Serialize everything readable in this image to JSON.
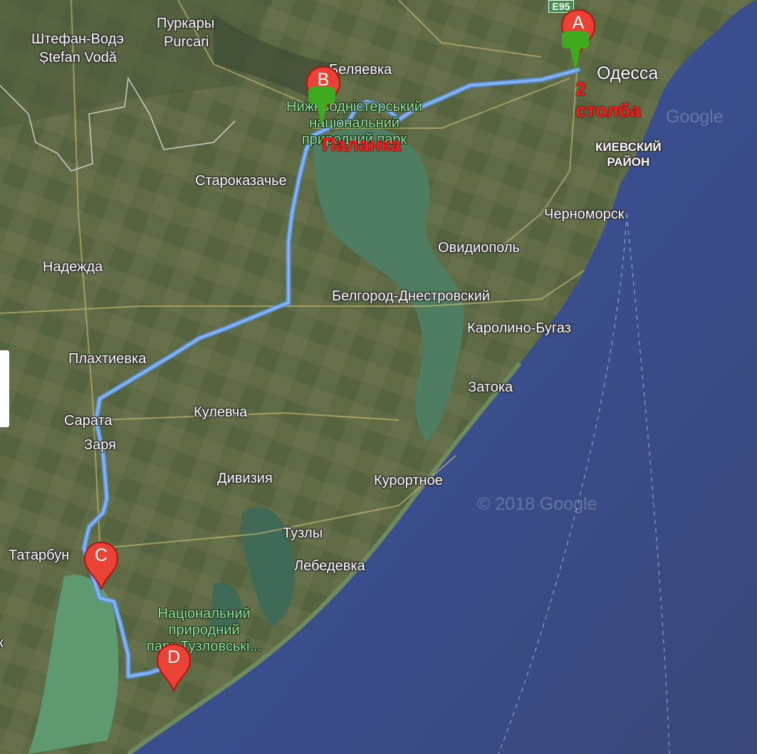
{
  "map": {
    "provider_watermark": "Google",
    "copyright": "© 2018 Google",
    "road_shield": "E95",
    "colors": {
      "land": "#5c6a45",
      "sea": "#3d4f93",
      "estuary": "#4e7d62",
      "route": "#7aaef0",
      "marker": "#ea4335",
      "flag": "#3faa1e",
      "annotation": "#ff1a1a"
    }
  },
  "places": {
    "shtefan_voda": "Штефан-Водэ",
    "shtefan_voda_latin": "Ștefan Vodă",
    "purkary": "Пуркары",
    "purcari": "Purcari",
    "belyaevka": "Беляевка",
    "odessa": "Одесса",
    "kievsky_district": "КИЕВСКИЙ\nРАЙОН",
    "starokazache": "Староказачье",
    "chernomorsk": "Черноморск",
    "ovidiopol": "Овидиополь",
    "nadezhda": "Надежда",
    "belgorod": "Белгород-Днестровский",
    "karolino": "Каролино-Бугаз",
    "plakhtievka": "Плахтиевка",
    "zatoka": "Затока",
    "sarata": "Сарата",
    "kulevcha": "Кулевча",
    "zarya": "Заря",
    "diviziya": "Дивизия",
    "kurortnoe": "Курортное",
    "tuzly": "Тузлы",
    "tatarbunary": "Татарбун",
    "lebedevka": "Лебедевка",
    "dniester_park": "Нижньодністерський\nнаціональний\nприродний парк",
    "tuzly_park": "Національний\nприродний\nпарк Тузловські...",
    "left_edge": "к"
  },
  "markers": [
    {
      "letter": "A"
    },
    {
      "letter": "B"
    },
    {
      "letter": "C"
    },
    {
      "letter": "D"
    }
  ],
  "annotations": {
    "palanka": "Паланка",
    "two_poles": "2\nстолба"
  }
}
